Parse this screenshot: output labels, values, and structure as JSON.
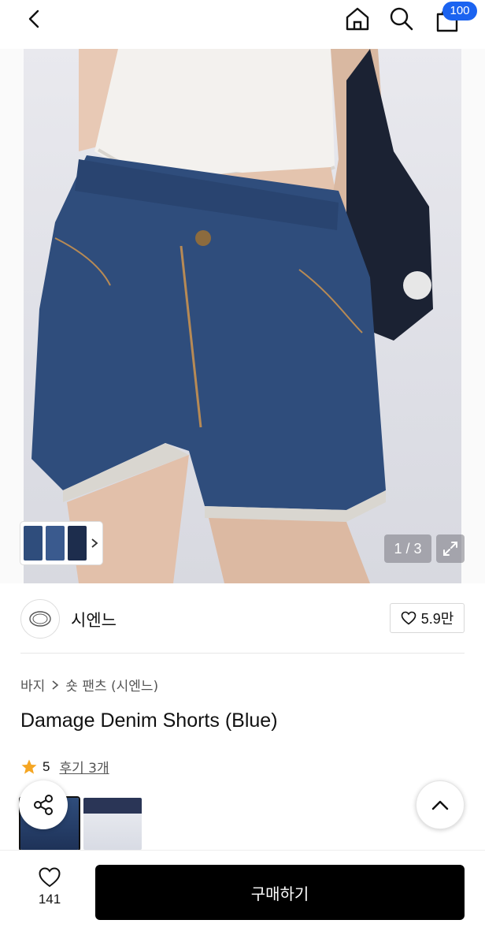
{
  "header": {
    "back_icon": "chevron-left-icon",
    "home_icon": "home-icon",
    "search_icon": "search-icon",
    "cart_icon": "cart-icon",
    "cart_badge": "100",
    "badge_color": "#1b63f0"
  },
  "gallery": {
    "counter": "1 / 3",
    "expand_icon": "expand-icon"
  },
  "brand": {
    "name": "시엔느",
    "likes": "5.9만"
  },
  "product": {
    "breadcrumb": [
      "바지",
      "숏 팬츠 (시엔느)"
    ],
    "title": "Damage Denim Shorts (Blue)",
    "rating": "5",
    "reviews": "후기 3개",
    "star_color": "#f5a623"
  },
  "bottom": {
    "wish_count": "141",
    "buy_label": "구매하기"
  }
}
